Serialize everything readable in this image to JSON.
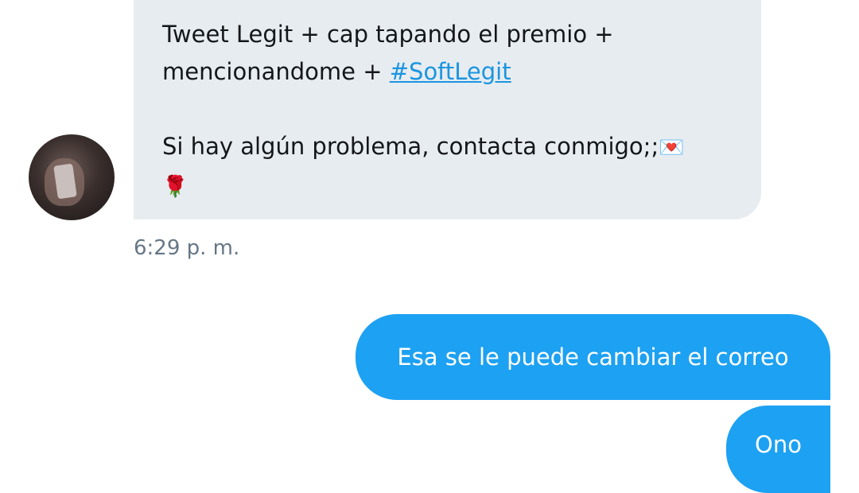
{
  "incoming_message": {
    "line1": "Tweet Legit + cap tapando el premio +",
    "line2_text": "mencionandome + ",
    "hashtag": "#SoftLegit",
    "line3_text": "Si hay algún problema, contacta conmigo;;",
    "emoji_envelope": "💌",
    "emoji_rose": "🌹",
    "timestamp": "6:29 p. m."
  },
  "outgoing_messages": [
    {
      "text": "Esa se le puede cambiar el correo"
    },
    {
      "text": "Ono"
    }
  ],
  "colors": {
    "incoming_bubble": "#e7ecf0",
    "outgoing_bubble": "#1da1f2",
    "hashtag": "#1b95e0",
    "timestamp": "#657786"
  }
}
